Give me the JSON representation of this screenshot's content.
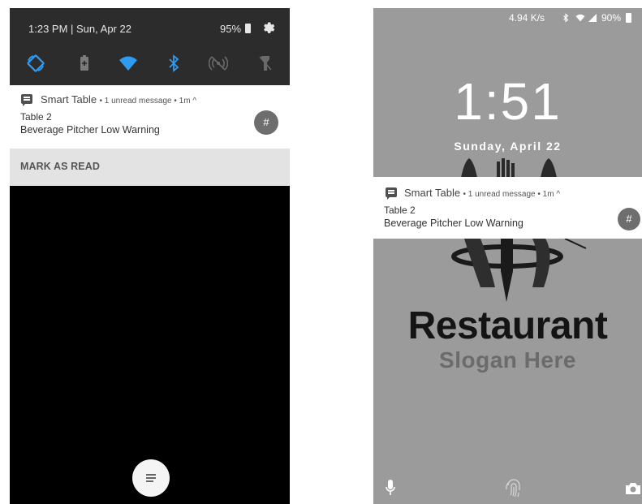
{
  "left_screen": {
    "quick_settings": {
      "time_date": "1:23 PM | Sun, Apr 22",
      "battery_text": "95%",
      "tiles": [
        {
          "icon": "auto-rotate-icon"
        },
        {
          "icon": "battery-saver-icon"
        },
        {
          "icon": "wifi-icon"
        },
        {
          "icon": "bluetooth-icon"
        },
        {
          "icon": "nfc-icon"
        },
        {
          "icon": "flashlight-icon"
        }
      ]
    },
    "notification": {
      "app_name": "Smart Table",
      "meta": "• 1 unread message • 1m ^",
      "title": "Table 2",
      "body": "Beverage Pitcher Low Warning",
      "avatar": "#"
    },
    "action": {
      "mark_as_read": "MARK AS READ"
    }
  },
  "right_screen": {
    "status_bar": {
      "net_speed": "4.94 K/s",
      "battery_text": "90%"
    },
    "lock": {
      "time": "1:51",
      "date": "Sunday, April 22"
    },
    "notification": {
      "app_name": "Smart Table",
      "meta": "• 1 unread message • 1m ^",
      "title": "Table 2",
      "body": "Beverage Pitcher Low Warning",
      "avatar": "#"
    },
    "wallpaper": {
      "title": "Restaurant",
      "slogan": "Slogan Here"
    }
  },
  "colors": {
    "quick_settings_bg": "#2c2c2c",
    "accent_blue": "#2f9bf0",
    "wallpaper_gray": "#9b9b9b"
  }
}
